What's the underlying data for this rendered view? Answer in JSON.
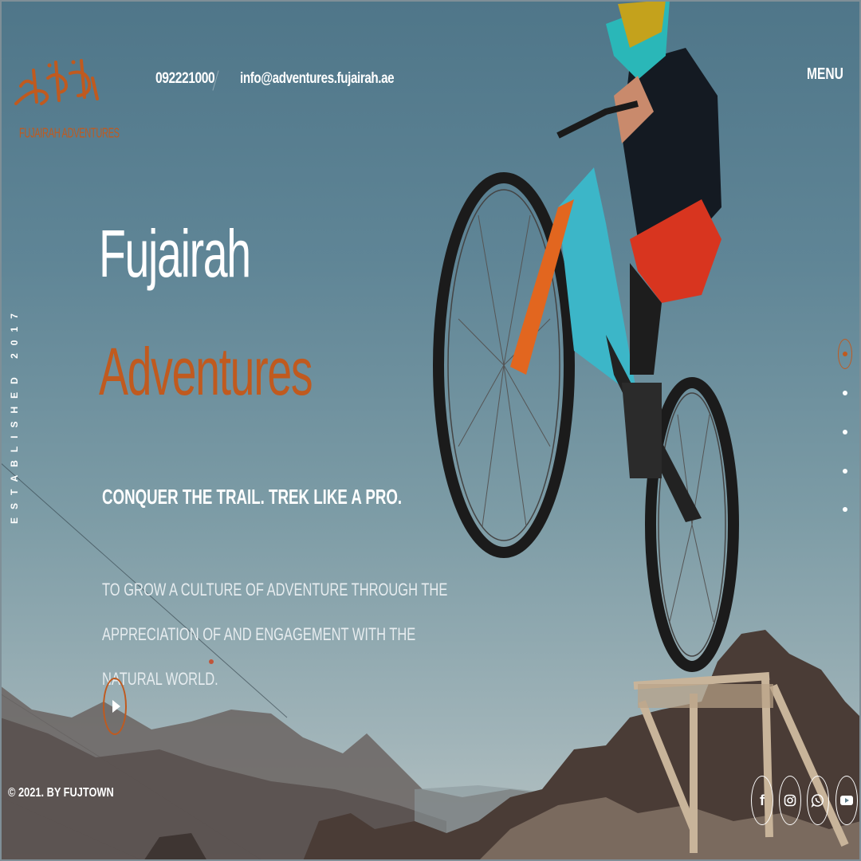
{
  "brand": {
    "logo_text": "FUJAIRAH ADVENTURES",
    "accent_color": "#c05a1f"
  },
  "header": {
    "phone": "092221000",
    "email": "info@adventures.fujairah.ae",
    "menu_label": "MENU"
  },
  "hero": {
    "vertical_text": "ESTABLISHED 2017",
    "title_line1": "Fujairah",
    "title_line2": "Adventures",
    "tagline": "CONQUER THE TRAIL. TREK LIKE A PRO.",
    "mission": "TO GROW A CULTURE OF ADVENTURE THROUGH THE APPRECIATION OF AND ENGAGEMENT WITH THE NATURAL WORLD.",
    "play_icon": "play-icon"
  },
  "pager": {
    "count": 5,
    "active_index": 0
  },
  "footer": {
    "copyright": "© 2021.  BY FUJTOWN"
  },
  "social": [
    {
      "name": "facebook",
      "icon": "facebook-icon",
      "glyph": "f"
    },
    {
      "name": "instagram",
      "icon": "instagram-icon",
      "glyph": ""
    },
    {
      "name": "whatsapp",
      "icon": "whatsapp-icon",
      "glyph": ""
    },
    {
      "name": "youtube",
      "icon": "youtube-icon",
      "glyph": ""
    }
  ]
}
